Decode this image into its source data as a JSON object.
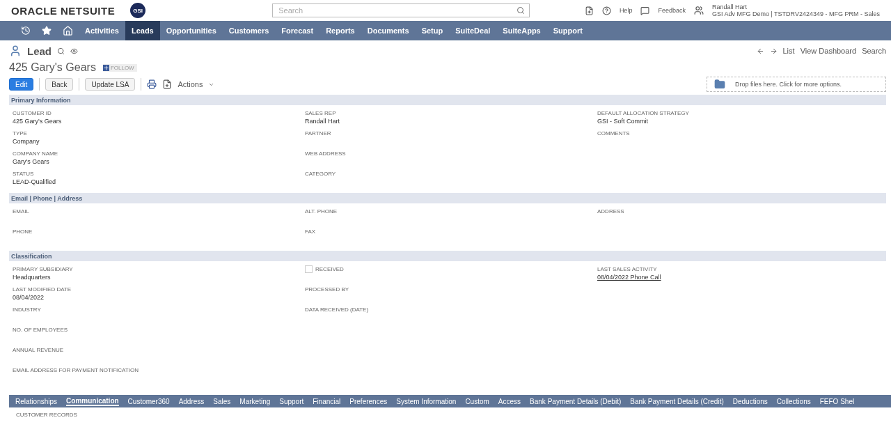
{
  "header": {
    "brand": "ORACLE NETSUITE",
    "badge": "GSI",
    "search": {
      "placeholder": "Search"
    },
    "help": "Help",
    "feedback": "Feedback",
    "user": {
      "name": "Randall Hart",
      "account": "GSI Adv MFG Demo | TSTDRV2424349 - MFG PRM - Sales"
    }
  },
  "nav": [
    {
      "label": "Activities",
      "selected": false
    },
    {
      "label": "Leads",
      "selected": true
    },
    {
      "label": "Opportunities",
      "selected": false
    },
    {
      "label": "Customers",
      "selected": false
    },
    {
      "label": "Forecast",
      "selected": false
    },
    {
      "label": "Reports",
      "selected": false
    },
    {
      "label": "Documents",
      "selected": false
    },
    {
      "label": "Setup",
      "selected": false
    },
    {
      "label": "SuiteDeal",
      "selected": false
    },
    {
      "label": "SuiteApps",
      "selected": false
    },
    {
      "label": "Support",
      "selected": false
    }
  ],
  "record": {
    "type": "Lead",
    "title": "425 Gary's Gears",
    "follow": "FOLLOW",
    "links": [
      "List",
      "View Dashboard",
      "Search"
    ],
    "buttons": [
      {
        "label": "Edit",
        "kind": "primary"
      },
      {
        "label": "Back",
        "kind": "secondary"
      },
      {
        "label": "Update LSA",
        "kind": "secondary"
      }
    ],
    "actions": "Actions",
    "drop": "Drop files here. Click for more options."
  },
  "sections": [
    {
      "title": "Primary Information",
      "columns": [
        [
          {
            "label": "CUSTOMER ID",
            "value": "425 Gary's Gears"
          },
          {
            "label": "TYPE",
            "value": "Company"
          },
          {
            "label": "COMPANY NAME",
            "value": "Gary's Gears"
          },
          {
            "label": "STATUS",
            "value": "LEAD-Qualified"
          }
        ],
        [
          {
            "label": "SALES REP",
            "value": "Randall Hart"
          },
          {
            "label": "PARTNER"
          },
          {
            "label": "WEB ADDRESS"
          },
          {
            "label": "CATEGORY"
          }
        ],
        [
          {
            "label": "DEFAULT ALLOCATION STRATEGY",
            "value": "GSI - Soft Commit"
          },
          {
            "label": "COMMENTS"
          }
        ]
      ]
    },
    {
      "title": "Email | Phone | Address",
      "columns": [
        [
          {
            "label": "EMAIL"
          },
          {
            "label": "PHONE"
          }
        ],
        [
          {
            "label": "ALT. PHONE"
          },
          {
            "label": "FAX"
          }
        ],
        [
          {
            "label": "ADDRESS"
          }
        ]
      ]
    },
    {
      "title": "Classification",
      "columns": [
        [
          {
            "label": "PRIMARY SUBSIDIARY",
            "value": "Headquarters"
          },
          {
            "label": "LAST MODIFIED DATE",
            "value": "08/04/2022"
          },
          {
            "label": "INDUSTRY"
          },
          {
            "label": "NO. OF EMPLOYEES"
          },
          {
            "label": "ANNUAL REVENUE"
          },
          {
            "label": "EMAIL ADDRESS FOR PAYMENT NOTIFICATION"
          }
        ],
        [
          {
            "label": "RECEIVED",
            "kind": "checkbox",
            "checked": false
          },
          {
            "label": "PROCESSED BY"
          },
          {
            "label": "DATA RECEIVED (DATE)"
          }
        ],
        [
          {
            "label": "LAST SALES ACTIVITY",
            "value": "08/04/2022 Phone Call",
            "kind": "link"
          }
        ]
      ]
    }
  ],
  "subtabs": [
    {
      "label": "Relationships",
      "selected": false
    },
    {
      "label": "Communication",
      "selected": true
    },
    {
      "label": "Customer360",
      "selected": false
    },
    {
      "label": "Address",
      "selected": false
    },
    {
      "label": "Sales",
      "selected": false
    },
    {
      "label": "Marketing",
      "selected": false
    },
    {
      "label": "Support",
      "selected": false
    },
    {
      "label": "Financial",
      "selected": false
    },
    {
      "label": "Preferences",
      "selected": false
    },
    {
      "label": "System Information",
      "selected": false
    },
    {
      "label": "Custom",
      "selected": false
    },
    {
      "label": "Access",
      "selected": false
    },
    {
      "label": "Bank Payment Details (Debit)",
      "selected": false
    },
    {
      "label": "Bank Payment Details (Credit)",
      "selected": false
    },
    {
      "label": "Deductions",
      "selected": false
    },
    {
      "label": "Collections",
      "selected": false
    },
    {
      "label": "FEFO Shel",
      "selected": false
    }
  ],
  "subtab_content": {
    "heading": "CUSTOMER RECORDS"
  }
}
